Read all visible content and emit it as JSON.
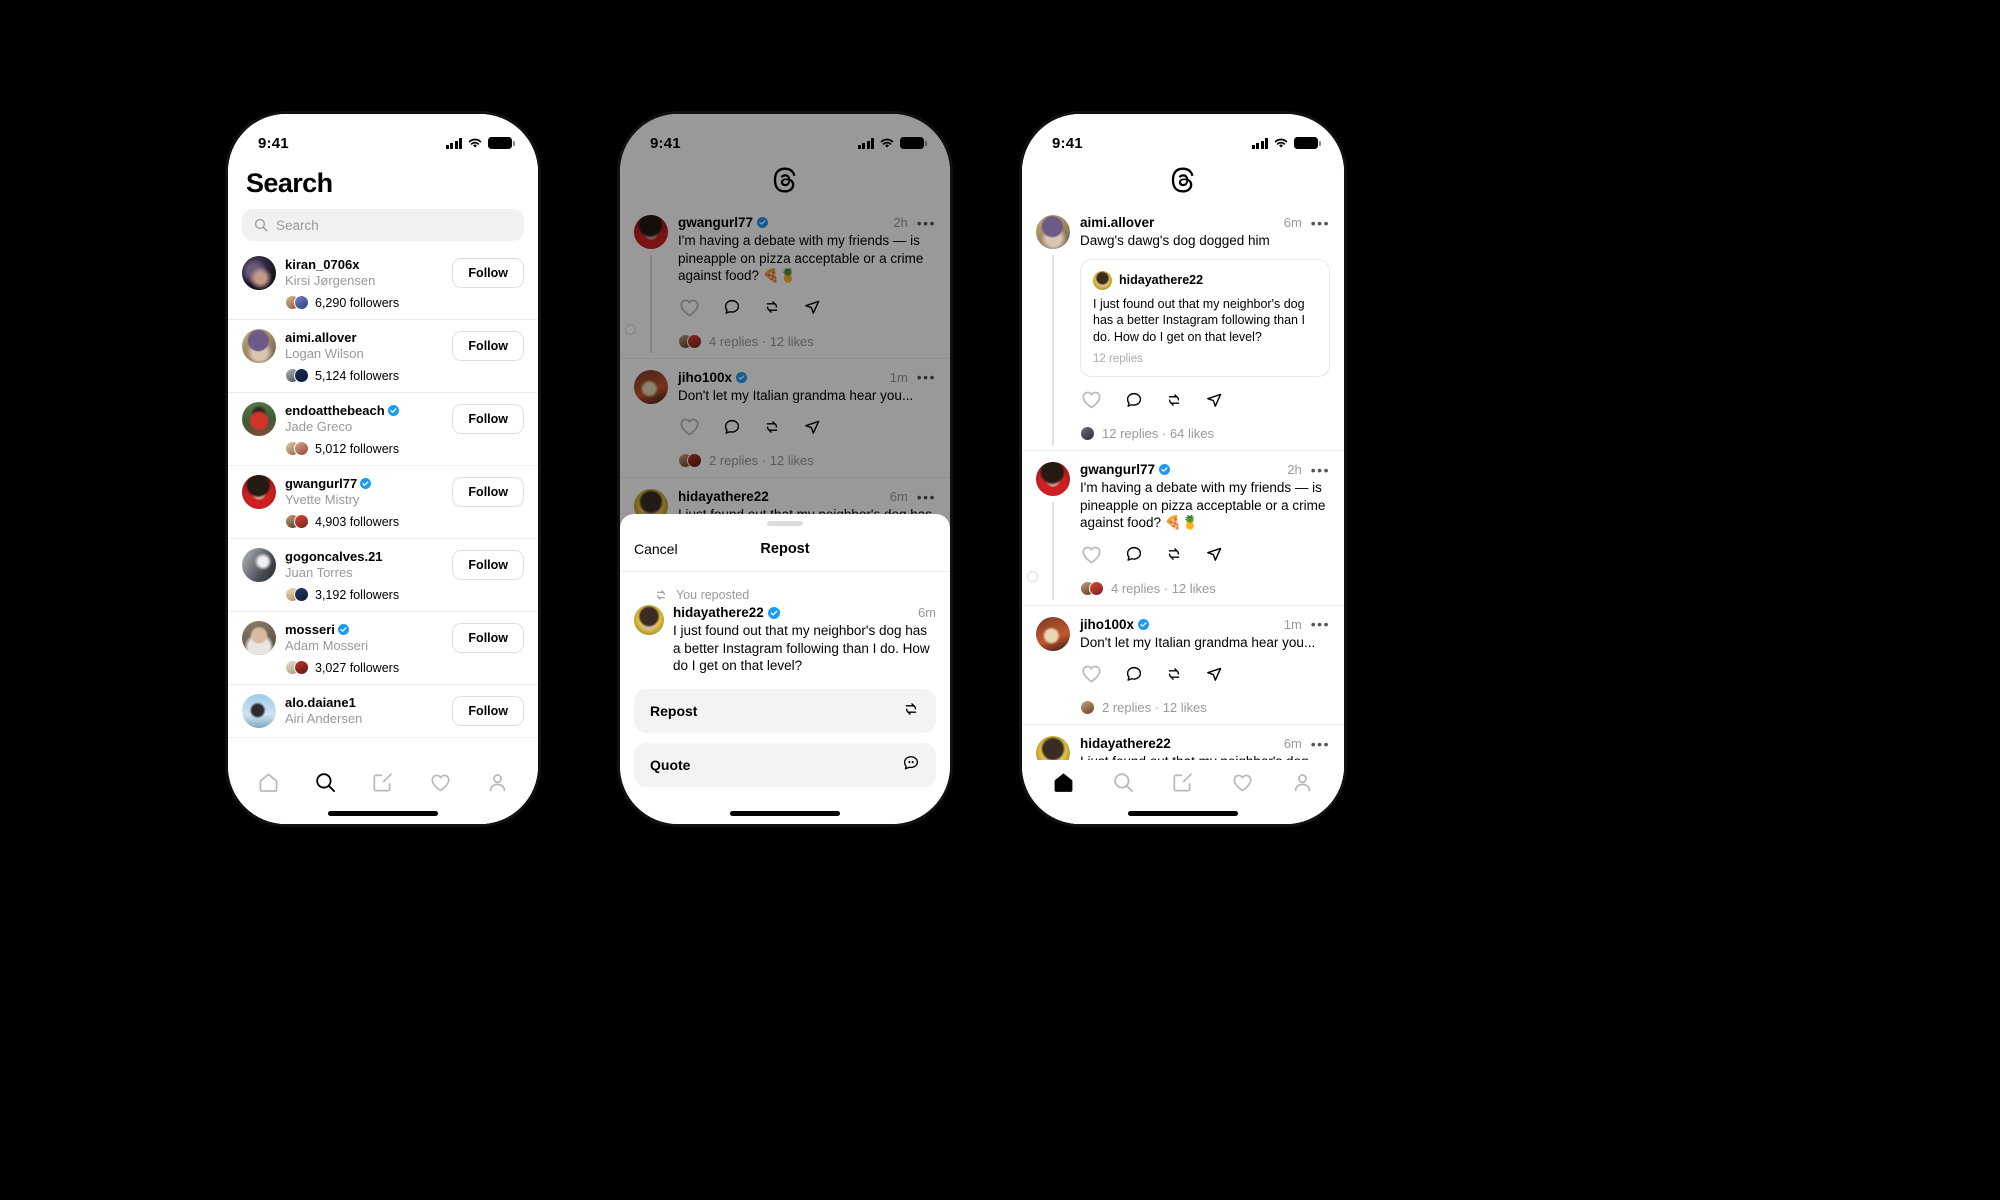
{
  "meta": {
    "background_color": "#000000",
    "accent_verified": "#1d9bf0",
    "surface": "#ffffff",
    "muted_text": "#999999"
  },
  "status_bar": {
    "time": "9:41",
    "cellular_icon": "cellular-bars-icon",
    "wifi_icon": "wifi-icon",
    "battery_icon": "battery-full-icon"
  },
  "search_screen": {
    "title": "Search",
    "search_input": {
      "placeholder": "Search",
      "value": "",
      "icon": "search-icon"
    },
    "follow_label": "Follow",
    "results": [
      {
        "username": "kiran_0706x",
        "verified": false,
        "fullname": "Kirsi Jørgensen",
        "followers": "6,290 followers",
        "avatar": "av1",
        "mini": [
          "mav-a",
          "mav-b"
        ]
      },
      {
        "username": "aimi.allover",
        "verified": false,
        "fullname": "Logan Wilson",
        "followers": "5,124 followers",
        "avatar": "av2",
        "mini": [
          "mav-c",
          "mav-d"
        ]
      },
      {
        "username": "endoatthebeach",
        "verified": true,
        "fullname": "Jade Greco",
        "followers": "5,012 followers",
        "avatar": "av3",
        "mini": [
          "mav-e",
          "mav-f"
        ]
      },
      {
        "username": "gwangurl77",
        "verified": true,
        "fullname": "Yvette Mistry",
        "followers": "4,903 followers",
        "avatar": "av4",
        "mini": [
          "mav-g",
          "mav-h"
        ]
      },
      {
        "username": "gogoncalves.21",
        "verified": false,
        "fullname": "Juan Torres",
        "followers": "3,192 followers",
        "avatar": "av5",
        "mini": [
          "mav-k",
          "mav-i"
        ]
      },
      {
        "username": "mosseri",
        "verified": true,
        "fullname": "Adam Mosseri",
        "followers": "3,027 followers",
        "avatar": "av6",
        "mini": [
          "mav-j",
          "mav-l"
        ]
      },
      {
        "username": "alo.daiane1",
        "verified": false,
        "fullname": "Airi Andersen",
        "followers": "",
        "avatar": "av7",
        "mini": []
      }
    ],
    "tabbar": {
      "items": [
        {
          "name": "home-icon",
          "active": false
        },
        {
          "name": "search-icon",
          "active": true
        },
        {
          "name": "compose-icon",
          "active": false
        },
        {
          "name": "heart-icon",
          "active": false
        },
        {
          "name": "profile-icon",
          "active": false
        }
      ]
    }
  },
  "repost_screen": {
    "logo": "threads-logo-icon",
    "feed": [
      {
        "username": "gwangurl77",
        "verified": true,
        "time": "2h",
        "text": "I'm having a debate with my friends — is pineapple on pizza acceptable or a crime against food? 🍕🍍",
        "meta": "4 replies · 12 likes",
        "avatar": "av4",
        "mini": [
          "mav-g",
          "mav-h"
        ],
        "thread_line": true,
        "reply_dot": true
      },
      {
        "username": "jiho100x",
        "verified": true,
        "time": "1m",
        "text": "Don't let my Italian grandma hear you...",
        "meta": "2 replies · 12 likes",
        "avatar": "av9",
        "mini": [
          "mav-n",
          "mav-l"
        ],
        "thread_line": false,
        "reply_dot": false
      },
      {
        "username": "hidayathere22",
        "verified": false,
        "time": "6m",
        "text": "I just found out that my neighbor's dog has a",
        "meta": "",
        "avatar": "av8",
        "mini": [],
        "thread_line": false,
        "reply_dot": false
      }
    ],
    "action_icons": [
      "heart-icon",
      "comment-icon",
      "repost-icon",
      "share-icon"
    ],
    "sheet": {
      "cancel_label": "Cancel",
      "title": "Repost",
      "reposted_label": "You reposted",
      "reposted_icon": "repost-icon",
      "preview": {
        "username": "hidayathere22",
        "verified": true,
        "time": "6m",
        "text": "I just found out that my neighbor's dog has a better Instagram following than I do. How do I get on that level?",
        "avatar": "av8"
      },
      "buttons": [
        {
          "label": "Repost",
          "icon": "repost-icon"
        },
        {
          "label": "Quote",
          "icon": "quote-icon"
        }
      ]
    }
  },
  "quote_screen": {
    "logo": "threads-logo-icon",
    "action_icons": [
      "heart-icon",
      "comment-icon",
      "repost-icon",
      "share-icon"
    ],
    "feed": [
      {
        "username": "aimi.allover",
        "verified": false,
        "time": "6m",
        "text": "Dawg's dawg's dog dogged him",
        "avatar": "av2",
        "mini": [
          "mav-m"
        ],
        "meta": "12 replies · 64 likes",
        "thread_line": true,
        "reply_dot": false,
        "quoted": {
          "username": "hidayathere22",
          "text": "I just found out that my neighbor's dog has a better Instagram following than I do. How do I get on that level?",
          "replies": "12 replies",
          "avatar": "av8"
        }
      },
      {
        "username": "gwangurl77",
        "verified": true,
        "time": "2h",
        "text": "I'm having a debate with my friends — is pineapple on pizza acceptable or a crime against food? 🍕🍍",
        "avatar": "av4",
        "mini": [
          "mav-g",
          "mav-h"
        ],
        "meta": "4 replies · 12 likes",
        "thread_line": true,
        "reply_dot": true,
        "quoted": null
      },
      {
        "username": "jiho100x",
        "verified": true,
        "time": "1m",
        "text": "Don't let my Italian grandma hear you...",
        "avatar": "av9",
        "mini": [
          "mav-n"
        ],
        "meta": "2 replies · 12 likes",
        "thread_line": false,
        "reply_dot": false,
        "quoted": null
      },
      {
        "username": "hidayathere22",
        "verified": false,
        "time": "6m",
        "text": "I just found out that my neighbor's dog has a better Instagram following than I do. How do I",
        "avatar": "av8",
        "mini": [],
        "meta": "",
        "thread_line": false,
        "reply_dot": false,
        "quoted": null
      }
    ],
    "tabbar": {
      "items": [
        {
          "name": "home-icon",
          "active": true
        },
        {
          "name": "search-icon",
          "active": false
        },
        {
          "name": "compose-icon",
          "active": false
        },
        {
          "name": "heart-icon",
          "active": false
        },
        {
          "name": "profile-icon",
          "active": false
        }
      ]
    }
  }
}
